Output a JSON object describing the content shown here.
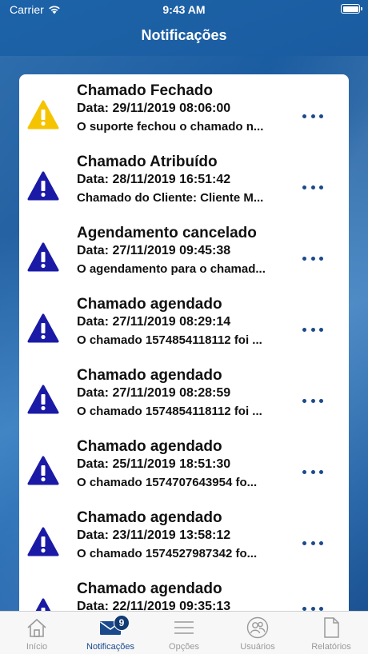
{
  "status_bar": {
    "carrier": "Carrier",
    "time": "9:43 AM"
  },
  "header": {
    "title": "Notificações"
  },
  "colors": {
    "warning_yellow": "#f5c400",
    "warning_blue": "#1a1aa6",
    "dots": "#1a4a8c",
    "tab_active": "#1a4a8c",
    "tab_inactive": "#9a9a9a"
  },
  "notifications": [
    {
      "title": "Chamado Fechado",
      "date": "Data: 29/11/2019 08:06:00",
      "message": "O suporte fechou o chamado n...",
      "icon": "warning-icon-yellow"
    },
    {
      "title": "Chamado Atribuído",
      "date": "Data: 28/11/2019 16:51:42",
      "message": "Chamado do Cliente: Cliente M...",
      "icon": "warning-icon-blue"
    },
    {
      "title": "Agendamento cancelado",
      "date": "Data: 27/11/2019 09:45:38",
      "message": "O agendamento para o chamad...",
      "icon": "warning-icon-blue"
    },
    {
      "title": "Chamado agendado",
      "date": "Data: 27/11/2019 08:29:14",
      "message": "O chamado 1574854118112 foi ...",
      "icon": "warning-icon-blue"
    },
    {
      "title": "Chamado agendado",
      "date": "Data: 27/11/2019 08:28:59",
      "message": "O chamado 1574854118112 foi ...",
      "icon": "warning-icon-blue"
    },
    {
      "title": "Chamado agendado",
      "date": "Data: 25/11/2019 18:51:30",
      "message": "O chamado 1574707643954 fo...",
      "icon": "warning-icon-blue"
    },
    {
      "title": "Chamado agendado",
      "date": "Data: 23/11/2019 13:58:12",
      "message": "O chamado 1574527987342 fo...",
      "icon": "warning-icon-blue"
    },
    {
      "title": "Chamado agendado",
      "date": "Data: 22/11/2019 09:35:13",
      "message": "",
      "icon": "warning-icon-blue"
    }
  ],
  "tab_bar": {
    "tabs": [
      {
        "label": "Início",
        "icon": "home-icon"
      },
      {
        "label": "Notificações",
        "icon": "mail-icon",
        "badge": "9",
        "active": true
      },
      {
        "label": "Opções",
        "icon": "menu-icon"
      },
      {
        "label": "Usuários",
        "icon": "users-icon"
      },
      {
        "label": "Relatórios",
        "icon": "document-icon"
      }
    ]
  }
}
